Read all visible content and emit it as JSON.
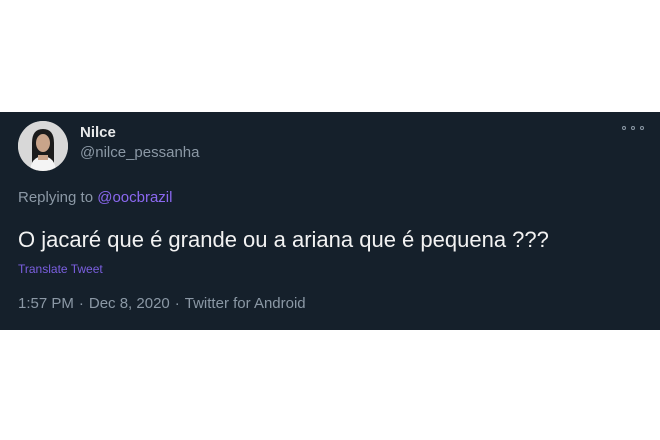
{
  "tweet": {
    "author": {
      "name": "Nilce",
      "handle": "@nilce_pessanha"
    },
    "reply": {
      "prefix": "Replying to",
      "mention": "@oocbrazil"
    },
    "text": "O jacaré que é grande ou a ariana que é pequena ???",
    "translate_label": "Translate Tweet",
    "meta": {
      "time": "1:57 PM",
      "date": "Dec 8, 2020",
      "source": "Twitter for Android",
      "separator": "·"
    },
    "icons": {
      "more": "more-options-icon",
      "avatar": "avatar"
    },
    "colors": {
      "background": "#15202b",
      "accent": "#8b68f0",
      "secondary_text": "#8b98a5"
    }
  }
}
